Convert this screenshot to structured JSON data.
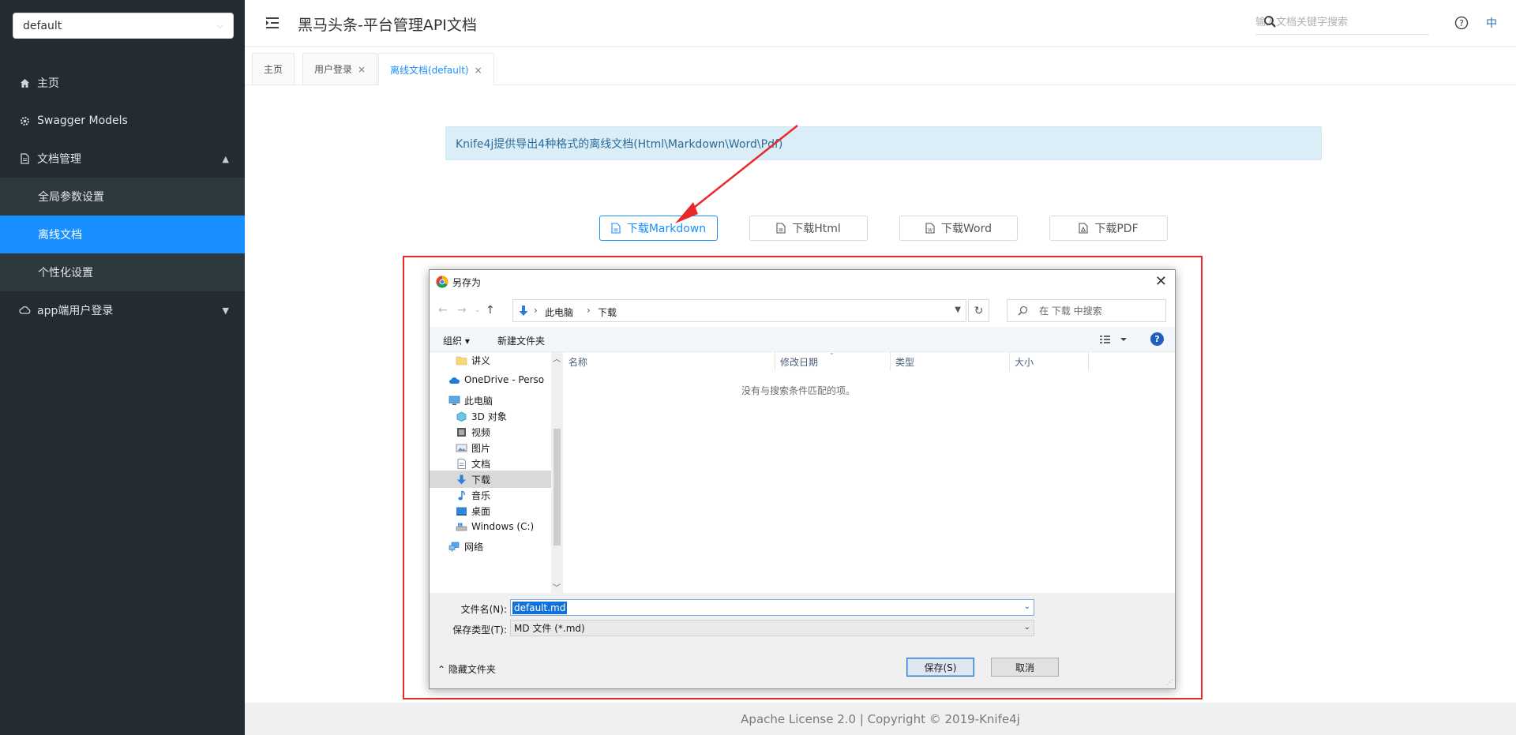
{
  "sidebar": {
    "group_select": "default",
    "items": [
      {
        "label": "主页"
      },
      {
        "label": "Swagger Models"
      },
      {
        "label": "文档管理"
      },
      {
        "label": "全局参数设置"
      },
      {
        "label": "离线文档"
      },
      {
        "label": "个性化设置"
      },
      {
        "label": "app端用户登录"
      }
    ]
  },
  "header": {
    "title": "黑马头条-平台管理API文档",
    "search_placeholder": "输入文档关键字搜索",
    "lang": "中"
  },
  "tabs": [
    {
      "label": "主页"
    },
    {
      "label": "用户登录",
      "close": "×"
    },
    {
      "label": "离线文档(default)",
      "close": "×"
    }
  ],
  "content": {
    "banner": "Knife4j提供导出4种格式的离线文档(Html\\Markdown\\Word\\Pdf)",
    "buttons": {
      "markdown": "下载Markdown",
      "html": "下载Html",
      "word": "下载Word",
      "pdf": "下载PDF"
    }
  },
  "footer": "Apache License 2.0 | Copyright © 2019-Knife4j",
  "dialog": {
    "title": "另存为",
    "close": "✕",
    "address": {
      "pc": "此电脑",
      "folder": "下载"
    },
    "search_placeholder": "在 下载 中搜索",
    "toolbar": {
      "organize": "组织 ▾",
      "new_folder": "新建文件夹"
    },
    "tree": [
      "讲义",
      "OneDrive - Perso",
      "此电脑",
      "3D 对象",
      "视频",
      "图片",
      "文档",
      "下载",
      "音乐",
      "桌面",
      "Windows (C:)",
      "网络"
    ],
    "columns": [
      "名称",
      "修改日期",
      "类型",
      "大小"
    ],
    "empty_message": "没有与搜索条件匹配的项。",
    "filename_label": "文件名(N):",
    "filename_value": "default.md",
    "filetype_label": "保存类型(T):",
    "filetype_value": "MD 文件 (*.md)",
    "hide_folders": "隐藏文件夹",
    "save": "保存(S)",
    "cancel": "取消"
  },
  "colors": {
    "sidebar_bg": "#222c32",
    "accent": "#1890ff",
    "highlight": "#e8282b"
  }
}
